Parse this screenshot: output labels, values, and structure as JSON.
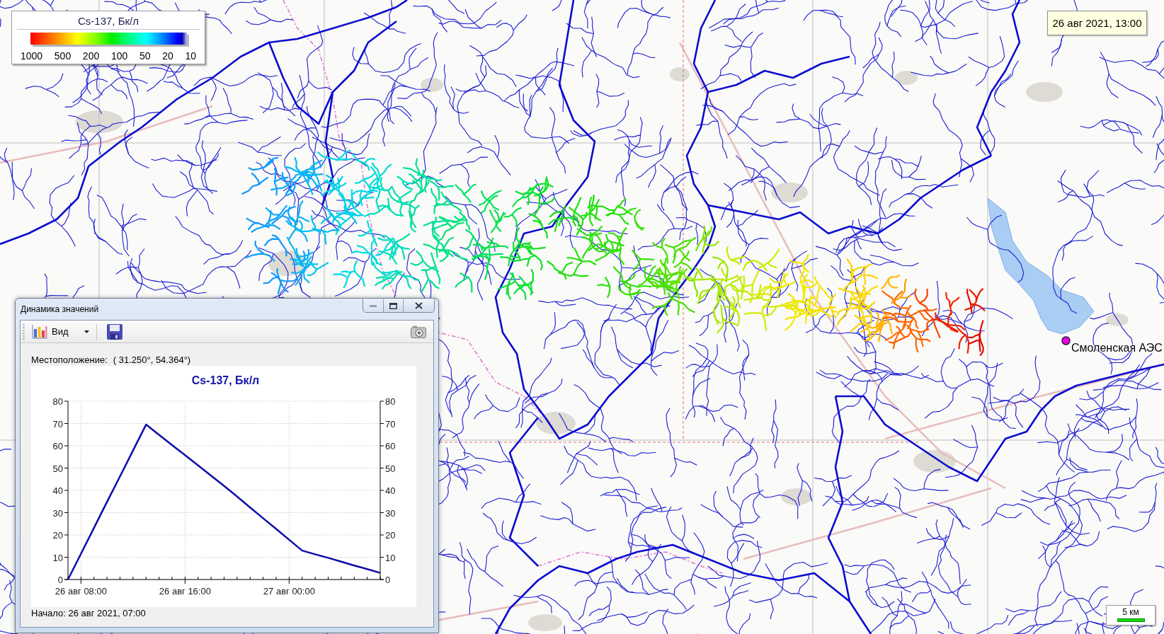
{
  "map": {
    "legend": {
      "title": "Cs-137, Бк/л",
      "scale_labels": [
        "1000",
        "500",
        "200",
        "100",
        "50",
        "20",
        "10"
      ]
    },
    "timestamp": "26 авг 2021, 13:00",
    "marker": {
      "label": "Смоленская АЭС"
    },
    "scale_bar": {
      "label": "5 км"
    }
  },
  "chart_window": {
    "title": "Динамика значений",
    "title_buttons": [
      {
        "kind": "minimize",
        "disabled": true
      },
      {
        "kind": "maximize",
        "disabled": false
      },
      {
        "kind": "close",
        "disabled": false
      }
    ],
    "toolbar": {
      "items": [
        {
          "kind": "dropdown",
          "label": "Вид"
        },
        {
          "kind": "save"
        }
      ],
      "right_items": [
        {
          "kind": "camera"
        }
      ]
    },
    "location_label": "Местоположение:",
    "location": "( 31.250°, 54.364°)",
    "chart_data": {
      "type": "line",
      "title": "Cs-137, Бк/л",
      "grid": true,
      "categories": [
        null,
        "26 авг 08:00",
        null,
        null,
        null,
        null,
        null,
        null,
        null,
        "26 авг 16:00",
        null,
        null,
        null,
        null,
        null,
        null,
        null,
        "27 авг 00:00",
        null,
        null,
        null,
        null,
        null,
        null,
        null
      ],
      "series": [
        {
          "color": "#0c0ca8",
          "values": [
            0,
            11.6,
            23.2,
            34.8,
            46.3,
            57.9,
            69.5,
            64.9,
            60.3,
            55.8,
            51.2,
            46.6,
            42,
            37.2,
            32.3,
            27.5,
            22.7,
            17.8,
            13,
            11.3,
            9.7,
            8,
            6.3,
            4.7,
            3
          ]
        }
      ],
      "ylim": [
        0,
        80
      ],
      "y2lim": [
        0,
        80
      ],
      "yticks": [
        0,
        10,
        20,
        30,
        40,
        50,
        60,
        70,
        80
      ],
      "y2ticks": [
        0,
        10,
        20,
        30,
        40,
        50,
        60,
        70,
        80
      ]
    },
    "start": "Начало: 26 авг 2021, 07:00"
  }
}
